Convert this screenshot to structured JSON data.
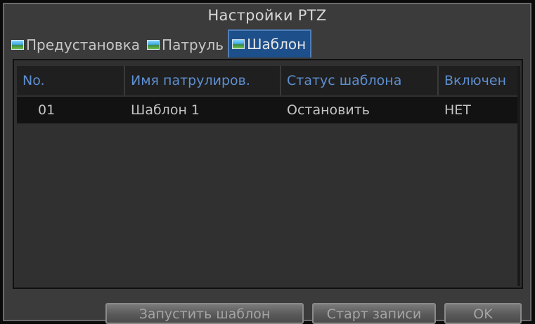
{
  "dialog": {
    "title": "Настройки PTZ",
    "tabs": [
      {
        "label": "Предустановка",
        "icon": "image-icon",
        "active": false
      },
      {
        "label": "Патруль",
        "icon": "image-icon",
        "active": false
      },
      {
        "label": "Шаблон",
        "icon": "image-icon",
        "active": true
      }
    ]
  },
  "table": {
    "columns": [
      "No.",
      "Имя патрулиров.",
      "Статус шаблона",
      "Включен"
    ],
    "rows": [
      {
        "no": "01",
        "name": "Шаблон 1",
        "status": "Остановить",
        "enabled": "НЕТ"
      }
    ]
  },
  "buttons": {
    "start_pattern": "Запустить шаблон",
    "start_record": "Старт записи",
    "ok": "OK"
  },
  "colors": {
    "panel": "#3b3b3b",
    "header_text": "#5e8fd0",
    "active_tab": "#1d4f8a",
    "row_bg": "#121212"
  }
}
